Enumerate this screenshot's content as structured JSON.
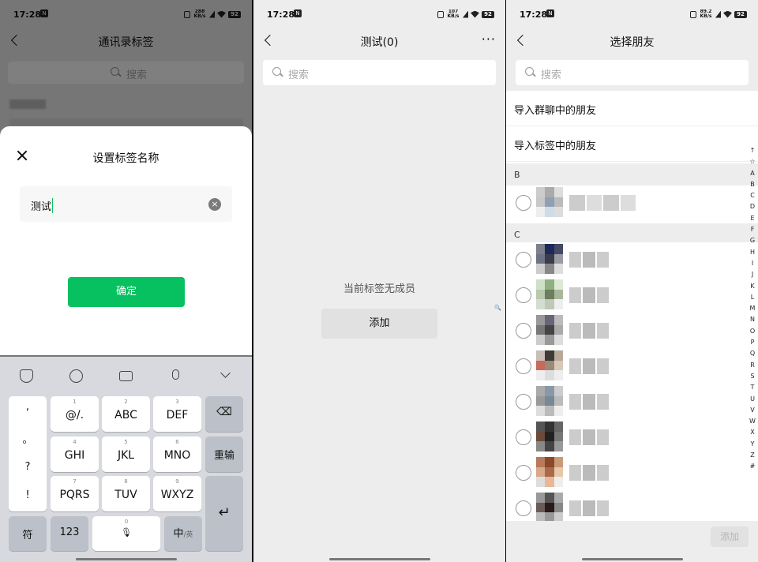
{
  "status": {
    "time": "17:28",
    "speeds": [
      "288 KB/s",
      "107 KB/s",
      "89.2 KB/s"
    ],
    "battery": "92"
  },
  "panel1": {
    "title": "通讯录标签",
    "search_placeholder": "搜索",
    "dialog": {
      "title": "设置标签名称",
      "input_value": "测试",
      "confirm_label": "确定"
    },
    "keyboard": {
      "punct": [
        ",",
        "。",
        "?",
        "!"
      ],
      "rows": [
        [
          {
            "num": "1",
            "label": "@/."
          },
          {
            "num": "2",
            "label": "ABC"
          },
          {
            "num": "3",
            "label": "DEF"
          }
        ],
        [
          {
            "num": "4",
            "label": "GHI"
          },
          {
            "num": "5",
            "label": "JKL"
          },
          {
            "num": "6",
            "label": "MNO"
          }
        ],
        [
          {
            "num": "7",
            "label": "PQRS"
          },
          {
            "num": "8",
            "label": "TUV"
          },
          {
            "num": "9",
            "label": "WXYZ"
          }
        ]
      ],
      "reinput_label": "重输",
      "symbol_label": "符",
      "num_label": "123",
      "space_num": "0",
      "lang_label": "中",
      "lang_sub": "/英"
    }
  },
  "panel2": {
    "title": "测试(0)",
    "search_placeholder": "搜索",
    "empty_text": "当前标签无成员",
    "add_label": "添加"
  },
  "panel3": {
    "title": "选择朋友",
    "search_placeholder": "搜索",
    "import_group": "导入群聊中的朋友",
    "import_tag": "导入标签中的朋友",
    "sections": [
      "B",
      "C"
    ],
    "index": [
      "↑",
      "☆",
      "A",
      "B",
      "C",
      "D",
      "E",
      "F",
      "G",
      "H",
      "I",
      "J",
      "K",
      "L",
      "M",
      "N",
      "O",
      "P",
      "Q",
      "R",
      "S",
      "T",
      "U",
      "V",
      "W",
      "X",
      "Y",
      "Z",
      "#"
    ],
    "add_label": "添加"
  },
  "colors": {
    "accent": "#07c160"
  }
}
